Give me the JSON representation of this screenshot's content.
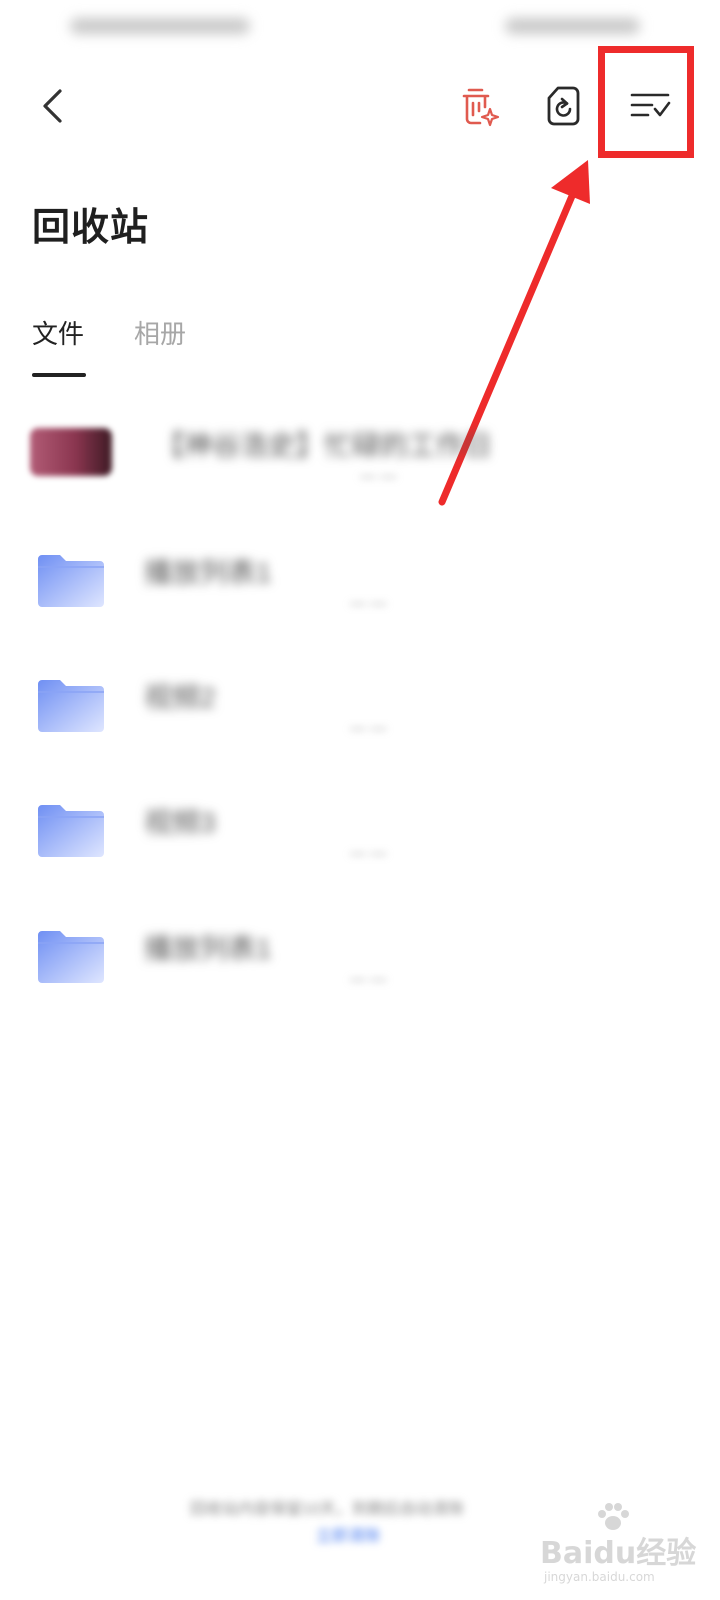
{
  "page": {
    "title": "回收站"
  },
  "header": {
    "back_icon": "chevron-left-icon",
    "smart_clean_icon": "trash-sparkle-icon",
    "restore_icon": "file-restore-icon",
    "select_icon": "list-check-icon",
    "accent_color": "#e05a4f",
    "highlight_color": "#ee2b2b"
  },
  "tabs": [
    {
      "label": "文件",
      "active": true
    },
    {
      "label": "相册",
      "active": false
    }
  ],
  "files": [
    {
      "name": "【神谷浩史】忙碌的工作日",
      "meta": "— —",
      "type": "video"
    },
    {
      "name": "播放列表1",
      "meta": "— —",
      "type": "folder"
    },
    {
      "name": "视频2",
      "meta": "— —",
      "type": "folder"
    },
    {
      "name": "视频3",
      "meta": "— —",
      "type": "folder"
    },
    {
      "name": "播放列表1",
      "meta": "— —",
      "type": "folder"
    }
  ],
  "footer": {
    "note": "回收站内容保留10天，到期后自动清除",
    "link": "立即清除"
  },
  "watermark": {
    "main": "Baidu经验",
    "sub": "jingyan.baidu.com"
  }
}
